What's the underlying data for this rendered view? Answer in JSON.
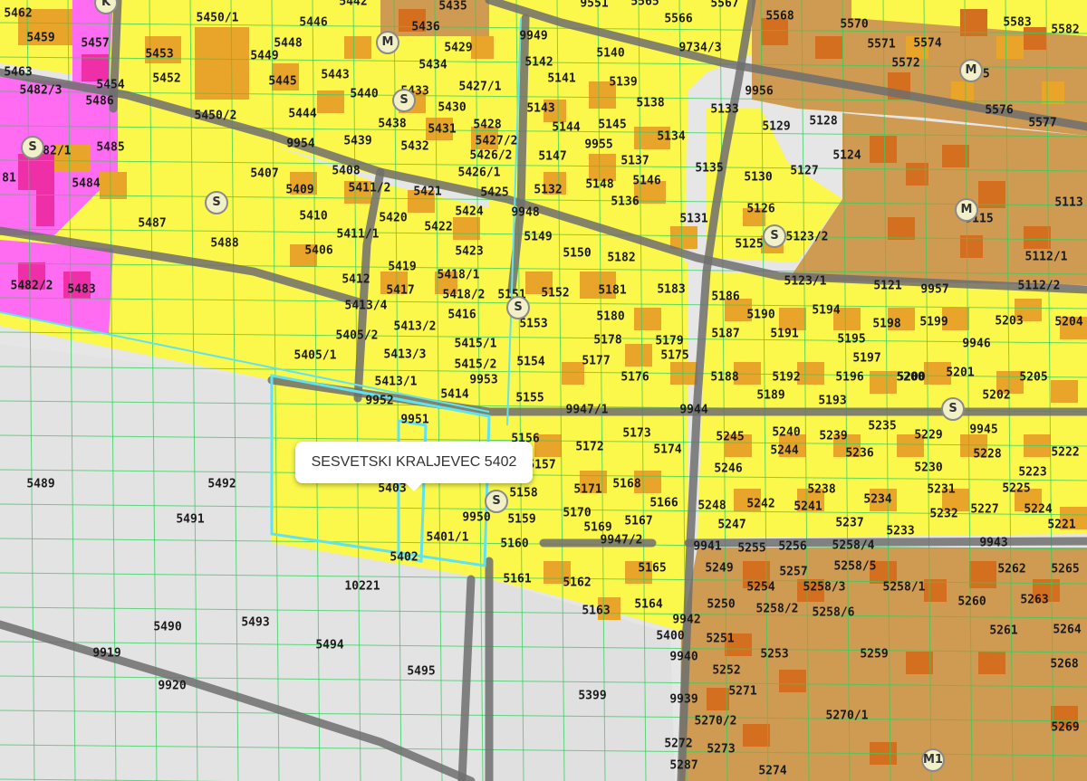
{
  "tooltip": {
    "text": "SESVETSKI KRALJEVEC 5402"
  },
  "colors": {
    "background": "#e6e6e6",
    "residential_zone": "#fbf84b",
    "building": "#e9a52a",
    "mixed_zone": "#cf9a52",
    "mixed_building": "#d46f20",
    "public_zone": "#ff6cf2",
    "public_building": "#ee2fa8",
    "parcel_line": "#2fd05c",
    "road": "#6f6f6f",
    "selection": "#5fe3f0"
  },
  "zone_symbols": [
    "S",
    "S",
    "S",
    "S",
    "M",
    "S",
    "S",
    "S",
    "M",
    "M",
    "M1",
    "K"
  ],
  "parcels": [
    "5462",
    "5459",
    "5457",
    "5463",
    "5482/3",
    "5486",
    "5454",
    "5482/1",
    "5485",
    "81",
    "5484",
    "5487",
    "5482/2",
    "5483",
    "5489",
    "5492",
    "5491",
    "5490",
    "9919",
    "9920",
    "5493",
    "5494",
    "5495",
    "10221",
    "5450/1",
    "5446",
    "5448",
    "5449",
    "5453",
    "5452",
    "5445",
    "5444",
    "5450/2",
    "5443",
    "5440",
    "5442",
    "5436",
    "5435",
    "5429",
    "5434",
    "5433",
    "5430",
    "5438",
    "5431",
    "5432",
    "5439",
    "5427/1",
    "5428",
    "5427/2",
    "5426/2",
    "5426/1",
    "9954",
    "5407",
    "5409",
    "5408",
    "5411/2",
    "5410",
    "5411/1",
    "5406",
    "5412",
    "5413/4",
    "5405/2",
    "5405/1",
    "5488",
    "5421",
    "5420",
    "5422",
    "5424",
    "5425",
    "5423",
    "5419",
    "5417",
    "5418/1",
    "5418/2",
    "5416",
    "5413/2",
    "5413/3",
    "5415/1",
    "5415/2",
    "5413/1",
    "5414",
    "9953",
    "9952",
    "9951",
    "5403",
    "5401/1",
    "5402",
    "9949",
    "9551",
    "5565",
    "5566",
    "5567",
    "5142",
    "5141",
    "5140",
    "9734/3",
    "5139",
    "5138",
    "5133",
    "5143",
    "5144",
    "5145",
    "5134",
    "5147",
    "9955",
    "5137",
    "5135",
    "5132",
    "5148",
    "5146",
    "5136",
    "5131",
    "9948",
    "5149",
    "5150",
    "5182",
    "5151",
    "5152",
    "5181",
    "5183",
    "5153",
    "5180",
    "5178",
    "5179",
    "5175",
    "5154",
    "5177",
    "5176",
    "5155",
    "9947/1",
    "9944",
    "5156",
    "5173",
    "5172",
    "5174",
    "5157",
    "5158",
    "5171",
    "5168",
    "5166",
    "9950",
    "5159",
    "5170",
    "5169",
    "5167",
    "5160",
    "9947/2",
    "5165",
    "5161",
    "5162",
    "5164",
    "5163",
    "5400",
    "9942",
    "9940",
    "9939",
    "5399",
    "5568",
    "5570",
    "5571",
    "5574",
    "5572",
    "5575",
    "5583",
    "5582",
    "9956",
    "5576",
    "5577",
    "5129",
    "5128",
    "5124",
    "5130",
    "5127",
    "5126",
    "5125",
    "5123/2",
    "5115",
    "5113",
    "5112/1",
    "5123/1",
    "5121",
    "9957",
    "5112/2",
    "5186",
    "5190",
    "5194",
    "5198",
    "5199",
    "5203",
    "5204",
    "5187",
    "5191",
    "5195",
    "9946",
    "5197",
    "5188",
    "5192",
    "5196",
    "5200",
    "5201",
    "5205",
    "5189",
    "5193",
    "5202",
    "5200",
    "9945",
    "5245",
    "5240",
    "5239",
    "5235",
    "5229",
    "5244",
    "5236",
    "5228",
    "5222",
    "5246",
    "5230",
    "5223",
    "5238",
    "5234",
    "5231",
    "5225",
    "5248",
    "5242",
    "5241",
    "5227",
    "5224",
    "5247",
    "5237",
    "5233",
    "5232",
    "5221",
    "9941",
    "5255",
    "5256",
    "5258/4",
    "9943",
    "5249",
    "5257",
    "5258/5",
    "5262",
    "5265",
    "5254",
    "5258/3",
    "5258/1",
    "5260",
    "5263",
    "5250",
    "5258/2",
    "5258/6",
    "5264",
    "5261",
    "5251",
    "5253",
    "5259",
    "5268",
    "5252",
    "5271",
    "5270/2",
    "5270/1",
    "5269",
    "5272",
    "5273",
    "5287",
    "5274"
  ]
}
